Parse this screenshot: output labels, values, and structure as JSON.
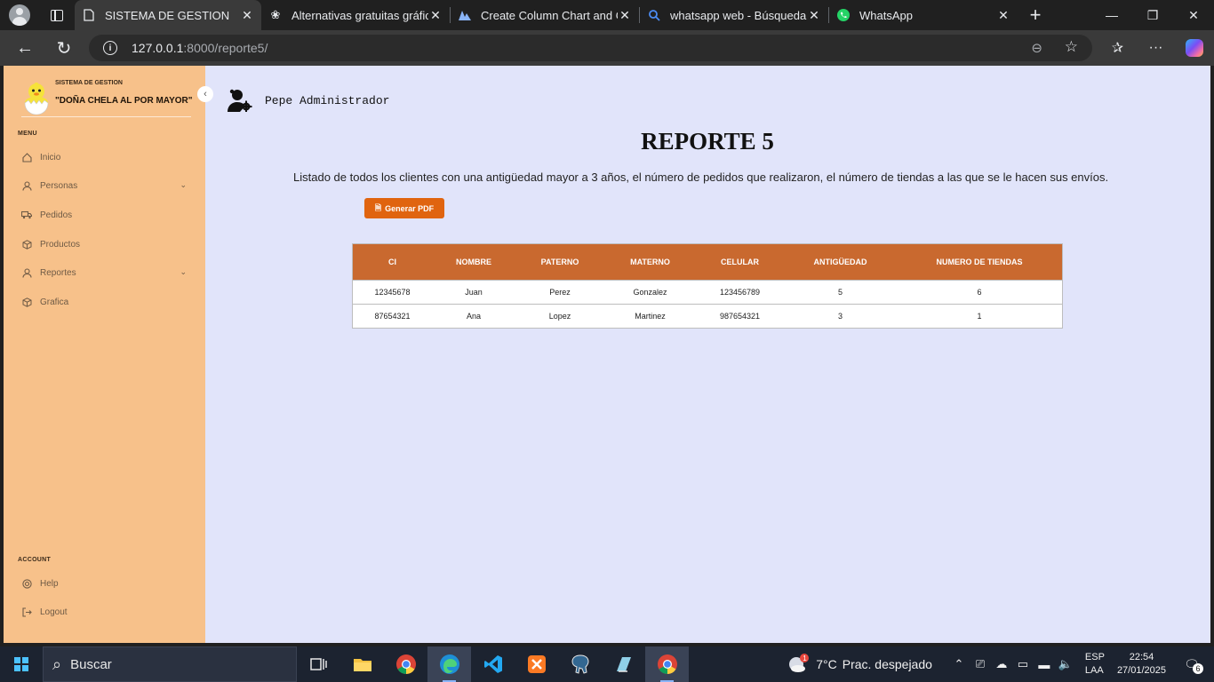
{
  "browser": {
    "tabs": [
      {
        "label": "SISTEMA DE GESTION",
        "active": true
      },
      {
        "label": "Alternativas gratuitas gráfica",
        "active": false
      },
      {
        "label": "Create Column Chart and Gr",
        "active": false
      },
      {
        "label": "whatsapp web - Búsqueda",
        "active": false
      },
      {
        "label": "WhatsApp",
        "active": false
      }
    ],
    "url_host": "127.0.0.1",
    "url_path": ":8000/reporte5/"
  },
  "sidebar": {
    "brand_small": "SISTEMA DE GESTION",
    "brand_name": "\"DOÑA CHELA AL POR MAYOR\"",
    "menu_heading": "MENU",
    "items": [
      {
        "label": "Inicio",
        "icon": "home-icon",
        "expandable": false
      },
      {
        "label": "Personas",
        "icon": "user-icon",
        "expandable": true
      },
      {
        "label": "Pedidos",
        "icon": "truck-icon",
        "expandable": false
      },
      {
        "label": "Productos",
        "icon": "box-icon",
        "expandable": false
      },
      {
        "label": "Reportes",
        "icon": "user-icon",
        "expandable": true
      },
      {
        "label": "Grafica",
        "icon": "box-icon",
        "expandable": false
      }
    ],
    "account_heading": "ACCOUNT",
    "account_items": [
      {
        "label": "Help",
        "icon": "help-icon"
      },
      {
        "label": "Logout",
        "icon": "logout-icon"
      }
    ]
  },
  "main": {
    "user_name": "Pepe Administrador",
    "title": "REPORTE 5",
    "subtitle": "Listado de todos los clientes con una antigüedad mayor a 3 años, el número de pedidos que realizaron, el número de tiendas a las que se le hacen sus envíos.",
    "pdf_button": "Generar PDF",
    "table": {
      "headers": [
        "CI",
        "NOMBRE",
        "PATERNO",
        "MATERNO",
        "CELULAR",
        "ANTIGÜEDAD",
        "NUMERO DE TIENDAS"
      ],
      "rows": [
        [
          "12345678",
          "Juan",
          "Perez",
          "Gonzalez",
          "123456789",
          "5",
          "6"
        ],
        [
          "87654321",
          "Ana",
          "Lopez",
          "Martinez",
          "987654321",
          "3",
          "1"
        ]
      ]
    }
  },
  "taskbar": {
    "search_text": "Buscar",
    "weather_temp": "7°C",
    "weather_desc": "Prac. despejado",
    "weather_badge": "1",
    "lang_1": "ESP",
    "lang_2": "LAA",
    "time": "22:54",
    "date": "27/01/2025",
    "notif_count": "6"
  },
  "colors": {
    "sidebar_bg": "#f7c18a",
    "content_bg": "#e1e4fa",
    "table_header": "#c9692f",
    "pdf_button": "#e0640f"
  }
}
